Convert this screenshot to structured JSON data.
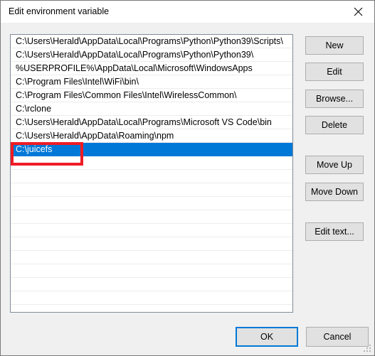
{
  "window": {
    "title": "Edit environment variable",
    "close_icon": "close-icon"
  },
  "path_list": {
    "entries": [
      "C:\\Users\\Herald\\AppData\\Local\\Programs\\Python\\Python39\\Scripts\\",
      "C:\\Users\\Herald\\AppData\\Local\\Programs\\Python\\Python39\\",
      "%USERPROFILE%\\AppData\\Local\\Microsoft\\WindowsApps",
      "C:\\Program Files\\Intel\\WiFi\\bin\\",
      "C:\\Program Files\\Common Files\\Intel\\WirelessCommon\\",
      "C:\\rclone",
      "C:\\Users\\Herald\\AppData\\Local\\Programs\\Microsoft VS Code\\bin",
      "C:\\Users\\Herald\\AppData\\Roaming\\npm",
      "C:\\juicefs"
    ],
    "selected_index": 8,
    "selected_value": "C:\\juicefs",
    "empty_row_count": 11,
    "selection_color": "#0078d7",
    "annotation_color": "#ef1c25"
  },
  "side_buttons": {
    "new": "New",
    "edit": "Edit",
    "browse": "Browse...",
    "delete": "Delete",
    "move_up": "Move Up",
    "move_down": "Move Down",
    "edit_text": "Edit text..."
  },
  "bottom_buttons": {
    "ok": "OK",
    "cancel": "Cancel",
    "focus_color": "#0078d7"
  }
}
